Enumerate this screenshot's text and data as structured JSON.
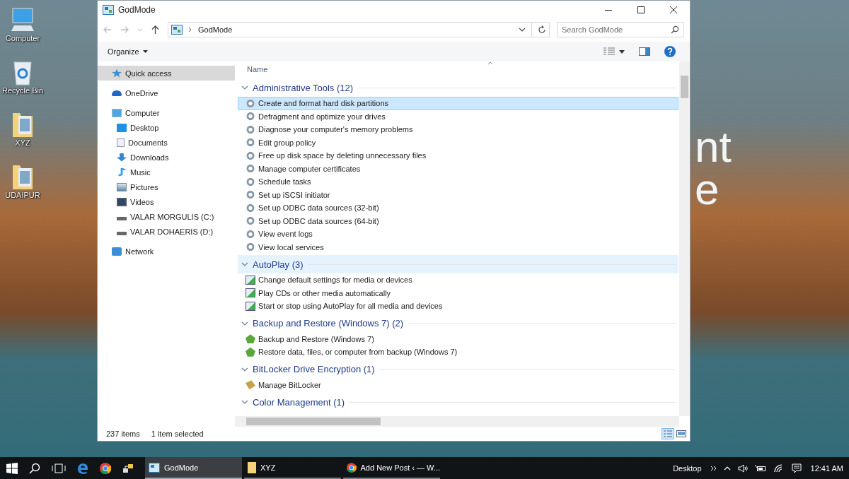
{
  "desktop": {
    "icons": [
      {
        "label": "Computer",
        "kind": "computer"
      },
      {
        "label": "Recycle Bin",
        "kind": "recycle"
      },
      {
        "label": "XYZ",
        "kind": "folder"
      },
      {
        "label": "UDAIPUR",
        "kind": "folder"
      }
    ],
    "wallpaper_text": [
      "nt",
      "e"
    ]
  },
  "window": {
    "title": "GodMode",
    "address": {
      "path": "GodMode"
    },
    "search": {
      "placeholder": "Search GodMode"
    },
    "toolbar": {
      "organize": "Organize"
    },
    "sidebar": {
      "items": [
        {
          "label": "Quick access",
          "kind": "star",
          "selected": true
        },
        {
          "label": "OneDrive",
          "kind": "cloud",
          "selected": false
        },
        {
          "label": "Computer",
          "kind": "computer",
          "selected": false,
          "children": [
            {
              "label": "Desktop",
              "kind": "desktop",
              "selected": false
            },
            {
              "label": "Documents",
              "kind": "documents",
              "selected": false
            },
            {
              "label": "Downloads",
              "kind": "downloads",
              "selected": false
            },
            {
              "label": "Music",
              "kind": "music",
              "selected": false
            },
            {
              "label": "Pictures",
              "kind": "pictures",
              "selected": false
            },
            {
              "label": "Videos",
              "kind": "videos",
              "selected": false
            },
            {
              "label": "VALAR MORGULIS (C:)",
              "kind": "drive",
              "selected": false
            },
            {
              "label": "VALAR DOHAERIS (D:)",
              "kind": "drive",
              "selected": false
            }
          ]
        },
        {
          "label": "Network",
          "kind": "network",
          "selected": false
        }
      ]
    },
    "column_header": "Name",
    "groups": [
      {
        "title": "Administrative Tools (12)",
        "kind": "admin",
        "expanded": true,
        "highlighted": false,
        "items": [
          {
            "label": "Create and format hard disk partitions",
            "selected": true
          },
          {
            "label": "Defragment and optimize your drives",
            "selected": false
          },
          {
            "label": "Diagnose your computer's memory problems",
            "selected": false
          },
          {
            "label": "Edit group policy",
            "selected": false
          },
          {
            "label": "Free up disk space by deleting unnecessary files",
            "selected": false
          },
          {
            "label": "Manage computer certificates",
            "selected": false
          },
          {
            "label": "Schedule tasks",
            "selected": false
          },
          {
            "label": "Set up iSCSI initiator",
            "selected": false
          },
          {
            "label": "Set up ODBC data sources (32-bit)",
            "selected": false
          },
          {
            "label": "Set up ODBC data sources (64-bit)",
            "selected": false
          },
          {
            "label": "View event logs",
            "selected": false
          },
          {
            "label": "View local services",
            "selected": false
          }
        ]
      },
      {
        "title": "AutoPlay (3)",
        "kind": "autoplay",
        "expanded": true,
        "highlighted": true,
        "items": [
          {
            "label": "Change default settings for media or devices",
            "selected": false
          },
          {
            "label": "Play CDs or other media automatically",
            "selected": false
          },
          {
            "label": "Start or stop using AutoPlay for all media and devices",
            "selected": false
          }
        ]
      },
      {
        "title": "Backup and Restore (Windows 7) (2)",
        "kind": "backup",
        "expanded": true,
        "highlighted": false,
        "items": [
          {
            "label": "Backup and Restore (Windows 7)",
            "selected": false
          },
          {
            "label": "Restore data, files, or computer from backup (Windows 7)",
            "selected": false
          }
        ]
      },
      {
        "title": "BitLocker Drive Encryption (1)",
        "kind": "bitlocker",
        "expanded": true,
        "highlighted": false,
        "items": [
          {
            "label": "Manage BitLocker",
            "selected": false
          }
        ]
      },
      {
        "title": "Color Management (1)",
        "expanded": true,
        "highlighted": false
      }
    ],
    "status_bar": {
      "count": "237 items",
      "selection": "1 item selected"
    }
  },
  "taskbar": {
    "items": [
      {
        "label": "GodMode",
        "kind": "explorer",
        "active": true
      },
      {
        "label": "XYZ",
        "kind": "folder",
        "active": false
      },
      {
        "label": "Add New Post ‹ — W...",
        "kind": "chrome",
        "active": false
      }
    ],
    "tray": {
      "desktop_label": "Desktop",
      "time": "12:41 AM"
    }
  }
}
